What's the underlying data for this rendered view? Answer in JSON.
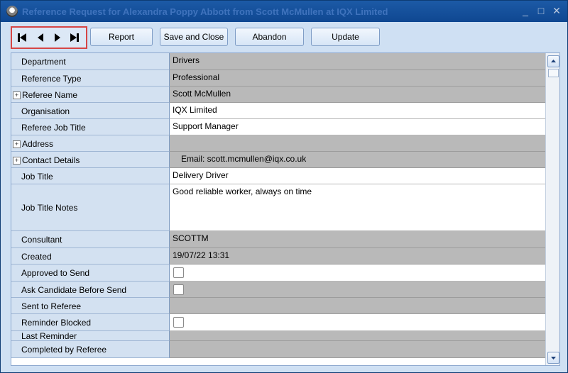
{
  "window": {
    "title": "Reference Request for Alexandra Poppy Abbott from Scott McMullen at IQX Limited"
  },
  "window_controls": {
    "minimize": "_",
    "maximize": "□",
    "close": "✕"
  },
  "toolbar": {
    "nav_buttons": [
      "first-record-icon",
      "previous-record-icon",
      "next-record-icon",
      "last-record-icon"
    ],
    "report_label": "Report",
    "save_close_label": "Save and Close",
    "abandon_label": "Abandon",
    "update_label": "Update"
  },
  "form": {
    "rows": [
      {
        "label": "Department",
        "value": "Drivers"
      },
      {
        "label": "Reference Type",
        "value": "Professional"
      },
      {
        "label": "Referee Name",
        "value": "Scott McMullen"
      },
      {
        "label": "Organisation",
        "value": "IQX Limited"
      },
      {
        "label": "Referee Job Title",
        "value": "Support Manager"
      },
      {
        "label": "Address",
        "value": ""
      },
      {
        "label": "Contact Details",
        "value": "Email: scott.mcmullen@iqx.co.uk"
      },
      {
        "label": "Job Title",
        "value": "Delivery Driver"
      },
      {
        "label": "Job Title Notes",
        "value": "Good reliable worker, always on time"
      },
      {
        "label": "Consultant",
        "value": "SCOTTM"
      },
      {
        "label": "Created",
        "value": "19/07/22 13:31"
      },
      {
        "label": "Approved to Send",
        "checked": false
      },
      {
        "label": "Ask Candidate Before Send",
        "checked": false
      },
      {
        "label": "Sent to Referee",
        "value": ""
      },
      {
        "label": "Reminder Blocked",
        "checked": false
      },
      {
        "label": "Last Reminder",
        "value": ""
      },
      {
        "label": "Completed by Referee",
        "value": ""
      }
    ]
  },
  "colors": {
    "title_bar": "#1c5aa6",
    "label_bg": "#d3e1f1",
    "readonly_bg": "#b9b9b9",
    "nav_highlight": "#d64545"
  }
}
